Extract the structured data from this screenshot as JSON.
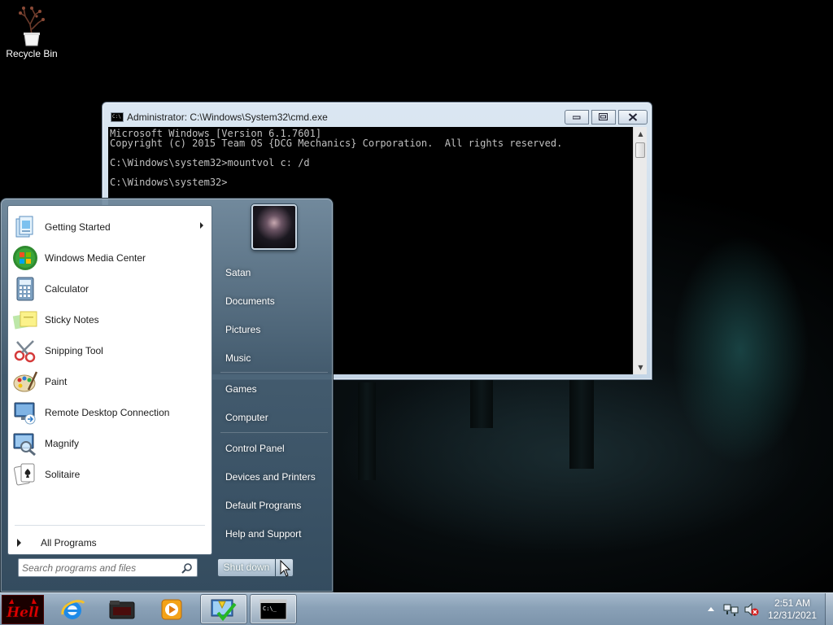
{
  "desktop": {
    "recycle_bin_label": "Recycle Bin"
  },
  "cmd": {
    "title": "Administrator: C:\\Windows\\System32\\cmd.exe",
    "lines": [
      "Microsoft Windows [Version 6.1.7601]",
      "Copyright (c) 2015 Team OS {DCG Mechanics} Corporation.  All rights reserved.",
      "",
      "C:\\Windows\\system32>mountvol c: /d",
      "",
      "C:\\Windows\\system32>"
    ],
    "icon_text": "C:\\"
  },
  "start_menu": {
    "programs": [
      {
        "label": "Getting Started",
        "icon": "getting-started-icon",
        "has_submenu": true
      },
      {
        "label": "Windows Media Center",
        "icon": "media-center-icon"
      },
      {
        "label": "Calculator",
        "icon": "calculator-icon"
      },
      {
        "label": "Sticky Notes",
        "icon": "sticky-notes-icon"
      },
      {
        "label": "Snipping Tool",
        "icon": "snipping-tool-icon"
      },
      {
        "label": "Paint",
        "icon": "paint-icon"
      },
      {
        "label": "Remote Desktop Connection",
        "icon": "remote-desktop-icon"
      },
      {
        "label": "Magnify",
        "icon": "magnify-icon"
      },
      {
        "label": "Solitaire",
        "icon": "solitaire-icon"
      }
    ],
    "all_programs_label": "All Programs",
    "search_placeholder": "Search programs and files",
    "right_items": [
      {
        "label": "Satan"
      },
      {
        "label": "Documents"
      },
      {
        "label": "Pictures"
      },
      {
        "label": "Music"
      },
      {
        "label": "Games"
      },
      {
        "label": "Computer"
      },
      {
        "label": "Control Panel"
      },
      {
        "label": "Devices and Printers"
      },
      {
        "label": "Default Programs"
      },
      {
        "label": "Help and Support"
      }
    ],
    "shutdown_label": "Shut down"
  },
  "taskbar": {
    "start_label": "Hell",
    "pinned": [
      {
        "icon": "internet-explorer-icon"
      },
      {
        "icon": "windows-explorer-icon"
      },
      {
        "icon": "media-player-icon"
      },
      {
        "icon": "action-center-icon"
      },
      {
        "icon": "command-prompt-icon"
      }
    ],
    "clock_time": "2:51 AM",
    "clock_date": "12/31/2021"
  },
  "colors": {
    "taskbar": "#8aa1b7",
    "console_bg": "#000000",
    "console_fg": "#c0c0c0",
    "start_orb": "#d40000"
  }
}
